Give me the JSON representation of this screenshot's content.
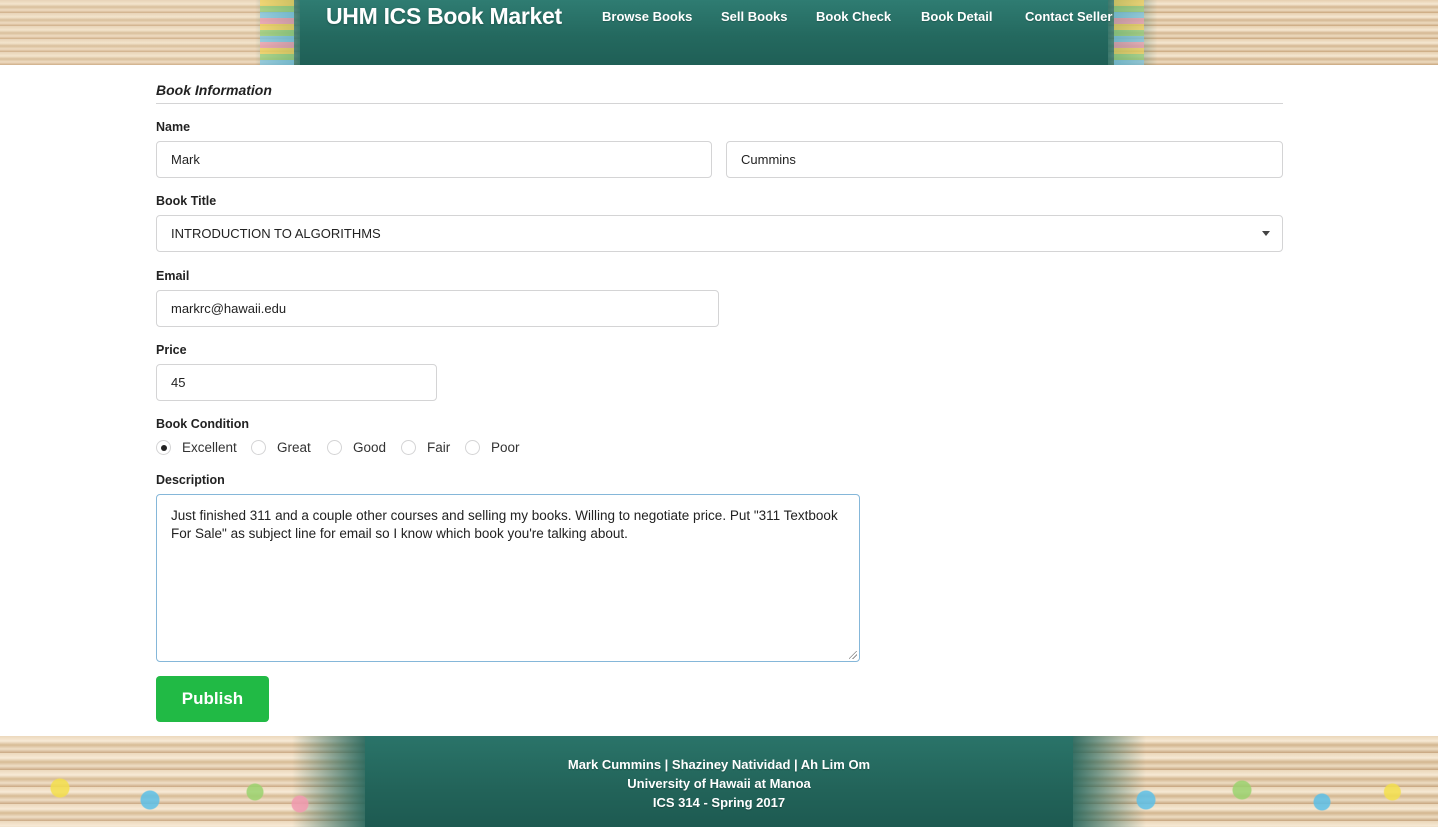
{
  "header": {
    "brand": "UHM ICS Book Market",
    "nav": [
      "Browse Books",
      "Sell Books",
      "Book Check",
      "Book Detail",
      "Contact Seller"
    ]
  },
  "form": {
    "section_title": "Book Information",
    "name": {
      "label": "Name",
      "first_value": "Mark",
      "last_value": "Cummins"
    },
    "book_title": {
      "label": "Book Title",
      "selected": "INTRODUCTION TO ALGORITHMS"
    },
    "email": {
      "label": "Email",
      "value": "markrc@hawaii.edu"
    },
    "price": {
      "label": "Price",
      "value": "45"
    },
    "condition": {
      "label": "Book Condition",
      "options": [
        "Excellent",
        "Great",
        "Good",
        "Fair",
        "Poor"
      ],
      "selected": "Excellent"
    },
    "description": {
      "label": "Description",
      "value": "Just finished 311 and a couple other courses and selling my books. Willing to negotiate price. Put \"311 Textbook For Sale\" as subject line for email so I know which book you're talking about."
    },
    "publish_label": "Publish"
  },
  "footer": {
    "authors": "Mark Cummins | Shaziney Natividad | Ah Lim Om",
    "university": "University of Hawaii at Manoa",
    "course": "ICS 314 - Spring 2017"
  },
  "colors": {
    "header_teal": "#24695f",
    "publish_green": "#21ba45",
    "focus_border": "#85b7d9",
    "input_border": "#d4d4d5"
  }
}
